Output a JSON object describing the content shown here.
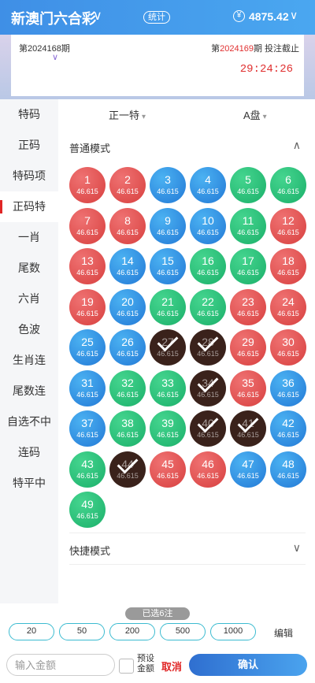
{
  "header": {
    "title": "新澳门六合彩",
    "title_icon": "chevron-down-icon",
    "stats_label": "统计",
    "coin_symbol": "¥",
    "balance": "4875.42",
    "balance_icon": "chevron-down-icon"
  },
  "period": {
    "previous_label": "第2024168期",
    "current_prefix": "第",
    "current_number": "2024169",
    "current_suffix": "期 投注截止",
    "countdown": "29:24:26"
  },
  "sidebar": {
    "items": [
      "特码",
      "正码",
      "特码项",
      "正码特",
      "一肖",
      "尾数",
      "六肖",
      "色波",
      "生肖连",
      "尾数连",
      "自选不中",
      "连码",
      "特平中"
    ],
    "active_index": 3
  },
  "selectors": {
    "position": "正一特",
    "market": "A盘"
  },
  "modes": {
    "normal_label": "普通模式",
    "normal_icon": "chevron-up-icon",
    "quick_label": "快捷模式",
    "quick_icon": "chevron-down-icon"
  },
  "balls": [
    {
      "n": "1",
      "odds": "46.615",
      "color": "red"
    },
    {
      "n": "2",
      "odds": "46.615",
      "color": "red"
    },
    {
      "n": "3",
      "odds": "46.615",
      "color": "blue"
    },
    {
      "n": "4",
      "odds": "46.615",
      "color": "blue"
    },
    {
      "n": "5",
      "odds": "46.615",
      "color": "green"
    },
    {
      "n": "6",
      "odds": "46.615",
      "color": "green"
    },
    {
      "n": "7",
      "odds": "46.615",
      "color": "red"
    },
    {
      "n": "8",
      "odds": "46.615",
      "color": "red"
    },
    {
      "n": "9",
      "odds": "46.615",
      "color": "blue"
    },
    {
      "n": "10",
      "odds": "46.615",
      "color": "blue"
    },
    {
      "n": "11",
      "odds": "46.615",
      "color": "green"
    },
    {
      "n": "12",
      "odds": "46.615",
      "color": "red"
    },
    {
      "n": "13",
      "odds": "46.615",
      "color": "red"
    },
    {
      "n": "14",
      "odds": "46.615",
      "color": "blue"
    },
    {
      "n": "15",
      "odds": "46.615",
      "color": "blue"
    },
    {
      "n": "16",
      "odds": "46.615",
      "color": "green"
    },
    {
      "n": "17",
      "odds": "46.615",
      "color": "green"
    },
    {
      "n": "18",
      "odds": "46.615",
      "color": "red"
    },
    {
      "n": "19",
      "odds": "46.615",
      "color": "red"
    },
    {
      "n": "20",
      "odds": "46.615",
      "color": "blue"
    },
    {
      "n": "21",
      "odds": "46.615",
      "color": "green"
    },
    {
      "n": "22",
      "odds": "46.615",
      "color": "green"
    },
    {
      "n": "23",
      "odds": "46.615",
      "color": "red"
    },
    {
      "n": "24",
      "odds": "46.615",
      "color": "red"
    },
    {
      "n": "25",
      "odds": "46.615",
      "color": "blue"
    },
    {
      "n": "26",
      "odds": "46.615",
      "color": "blue"
    },
    {
      "n": "27",
      "odds": "46.615",
      "color": "green",
      "selected": true
    },
    {
      "n": "28",
      "odds": "46.615",
      "color": "green",
      "selected": true
    },
    {
      "n": "29",
      "odds": "46.615",
      "color": "red"
    },
    {
      "n": "30",
      "odds": "46.615",
      "color": "red"
    },
    {
      "n": "31",
      "odds": "46.615",
      "color": "blue"
    },
    {
      "n": "32",
      "odds": "46.615",
      "color": "green"
    },
    {
      "n": "33",
      "odds": "46.615",
      "color": "green"
    },
    {
      "n": "34",
      "odds": "46.615",
      "color": "red",
      "selected": true
    },
    {
      "n": "35",
      "odds": "46.615",
      "color": "red"
    },
    {
      "n": "36",
      "odds": "46.615",
      "color": "blue"
    },
    {
      "n": "37",
      "odds": "46.615",
      "color": "blue"
    },
    {
      "n": "38",
      "odds": "46.615",
      "color": "green"
    },
    {
      "n": "39",
      "odds": "46.615",
      "color": "green"
    },
    {
      "n": "40",
      "odds": "46.615",
      "color": "red",
      "selected": true
    },
    {
      "n": "41",
      "odds": "46.615",
      "color": "blue",
      "selected": true
    },
    {
      "n": "42",
      "odds": "46.615",
      "color": "blue"
    },
    {
      "n": "43",
      "odds": "46.615",
      "color": "green"
    },
    {
      "n": "44",
      "odds": "46.615",
      "color": "green",
      "selected": true
    },
    {
      "n": "45",
      "odds": "46.615",
      "color": "red"
    },
    {
      "n": "46",
      "odds": "46.615",
      "color": "red"
    },
    {
      "n": "47",
      "odds": "46.615",
      "color": "blue"
    },
    {
      "n": "48",
      "odds": "46.615",
      "color": "blue"
    },
    {
      "n": "49",
      "odds": "46.615",
      "color": "green"
    }
  ],
  "bet_bar": {
    "selected_count_label": "已选6注",
    "chips": [
      "20",
      "50",
      "200",
      "500",
      "1000"
    ],
    "edit_label": "编辑",
    "amount_placeholder": "输入金额",
    "preset_label": "预设金额",
    "cancel_label": "取消",
    "confirm_label": "确认"
  },
  "colors": {
    "red_ball": "#d8403f",
    "blue_ball": "#2379d6",
    "green_ball": "#1bb06a",
    "selected_ball": "#3a221b",
    "accent_red": "#e02525",
    "header_blue": "#3f8fe6"
  }
}
